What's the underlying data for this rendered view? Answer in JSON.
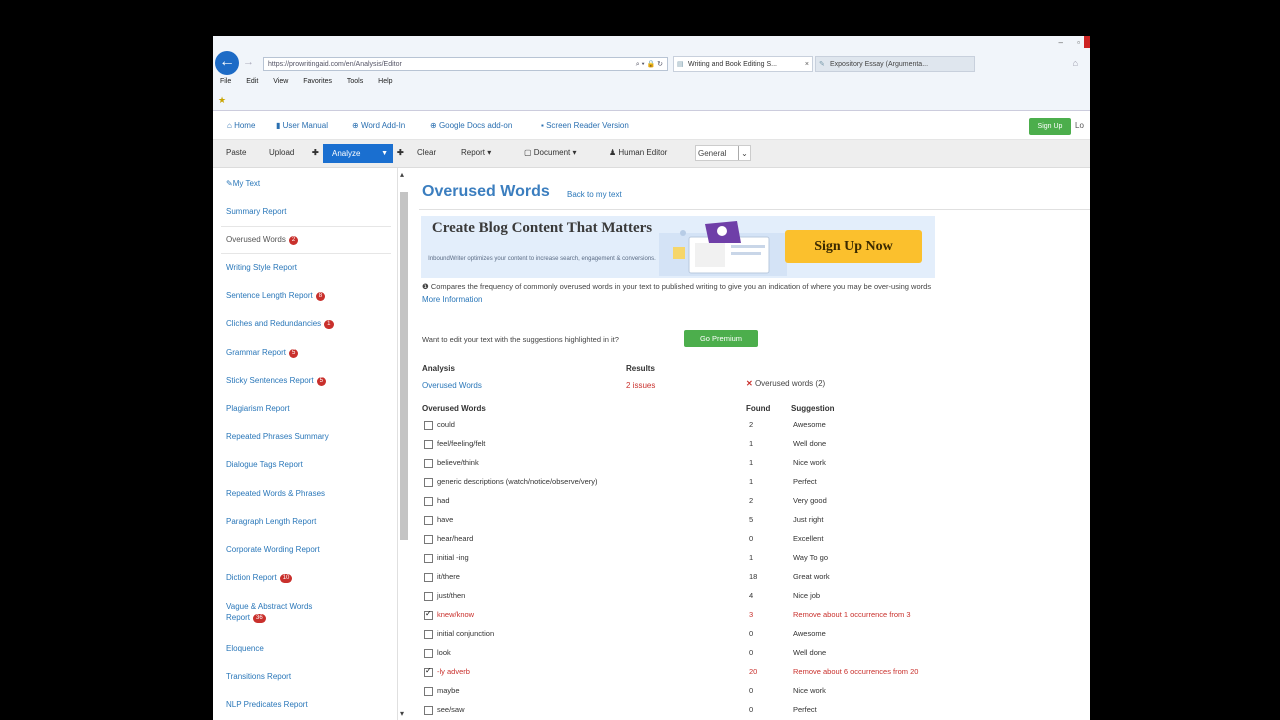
{
  "browser": {
    "url": "https://prowritingaid.com/en/Analysis/Editor",
    "tabs": [
      {
        "label": "Writing and Book Editing S...",
        "active": true
      },
      {
        "label": "Expository Essay (Argumenta...",
        "active": false
      }
    ],
    "menu": [
      "File",
      "Edit",
      "View",
      "Favorites",
      "Tools",
      "Help"
    ]
  },
  "site_nav": {
    "links": [
      "Home",
      "User Manual",
      "Word Add-In",
      "Google Docs add-on",
      "Screen Reader Version"
    ],
    "signup": "Sign Up",
    "login": "Lo"
  },
  "toolbar": {
    "paste": "Paste",
    "upload": "Upload",
    "analyze": "Analyze",
    "clear": "Clear",
    "report": "Report",
    "document": "Document",
    "human_editor": "Human Editor",
    "genre": "General"
  },
  "sidebar": {
    "items": [
      {
        "label": "My Text",
        "badge": null
      },
      {
        "label": "Summary Report",
        "badge": null
      },
      {
        "label": "Overused Words",
        "badge": "2"
      },
      {
        "label": "Writing Style Report",
        "badge": null
      },
      {
        "label": "Sentence Length Report",
        "badge": "8"
      },
      {
        "label": "Cliches and Redundancies",
        "badge": "1"
      },
      {
        "label": "Grammar Report",
        "badge": "5"
      },
      {
        "label": "Sticky Sentences Report",
        "badge": "5"
      },
      {
        "label": "Plagiarism Report",
        "badge": null
      },
      {
        "label": "Repeated Phrases Summary",
        "badge": null
      },
      {
        "label": "Dialogue Tags Report",
        "badge": null
      },
      {
        "label": "Repeated Words & Phrases",
        "badge": null
      },
      {
        "label": "Paragraph Length Report",
        "badge": null
      },
      {
        "label": "Corporate Wording Report",
        "badge": null
      },
      {
        "label": "Diction Report",
        "badge": "10"
      },
      {
        "label": "Vague & Abstract Words",
        "label2": "Report",
        "badge": "36"
      },
      {
        "label": "Eloquence",
        "badge": null
      },
      {
        "label": "Transitions Report",
        "badge": null
      },
      {
        "label": "NLP Predicates Report",
        "badge": null
      }
    ]
  },
  "main": {
    "title": "Overused Words",
    "back_link": "Back to my text",
    "banner": {
      "headline": "Create Blog Content That Matters",
      "subtext": "InboundWriter optimizes your content to increase search, engagement & conversions.",
      "button": "Sign Up Now"
    },
    "description": "Compares the frequency of commonly overused words in your text to published writing to give you an indication of where you may be over-using words",
    "more_info": "More Information",
    "edit_question": "Want to edit your text with the suggestions highlighted in it?",
    "go_premium": "Go Premium",
    "analysis_header": "Analysis",
    "results_header": "Results",
    "analysis_name": "Overused Words",
    "analysis_result": "2 issues",
    "analysis_summary": "Overused words (2)",
    "col_words": "Overused Words",
    "col_found": "Found",
    "col_suggestion": "Suggestion",
    "rows": [
      {
        "word": "could",
        "found": "2",
        "suggestion": "Awesome",
        "checked": false
      },
      {
        "word": "feel/feeling/felt",
        "found": "1",
        "suggestion": "Well done",
        "checked": false
      },
      {
        "word": "believe/think",
        "found": "1",
        "suggestion": "Nice work",
        "checked": false
      },
      {
        "word": "generic descriptions (watch/notice/observe/very)",
        "found": "1",
        "suggestion": "Perfect",
        "checked": false
      },
      {
        "word": "had",
        "found": "2",
        "suggestion": "Very good",
        "checked": false
      },
      {
        "word": "have",
        "found": "5",
        "suggestion": "Just right",
        "checked": false
      },
      {
        "word": "hear/heard",
        "found": "0",
        "suggestion": "Excellent",
        "checked": false
      },
      {
        "word": "initial -ing",
        "found": "1",
        "suggestion": "Way To go",
        "checked": false
      },
      {
        "word": "it/there",
        "found": "18",
        "suggestion": "Great work",
        "checked": false
      },
      {
        "word": "just/then",
        "found": "4",
        "suggestion": "Nice job",
        "checked": false
      },
      {
        "word": "knew/know",
        "found": "3",
        "suggestion": "Remove about 1 occurrence from 3",
        "checked": true
      },
      {
        "word": "initial conjunction",
        "found": "0",
        "suggestion": "Awesome",
        "checked": false
      },
      {
        "word": "look",
        "found": "0",
        "suggestion": "Well done",
        "checked": false
      },
      {
        "word": "-ly adverb",
        "found": "20",
        "suggestion": "Remove about 6 occurrences from 20",
        "checked": true
      },
      {
        "word": "maybe",
        "found": "0",
        "suggestion": "Nice work",
        "checked": false
      },
      {
        "word": "see/saw",
        "found": "0",
        "suggestion": "Perfect",
        "checked": false
      }
    ]
  }
}
